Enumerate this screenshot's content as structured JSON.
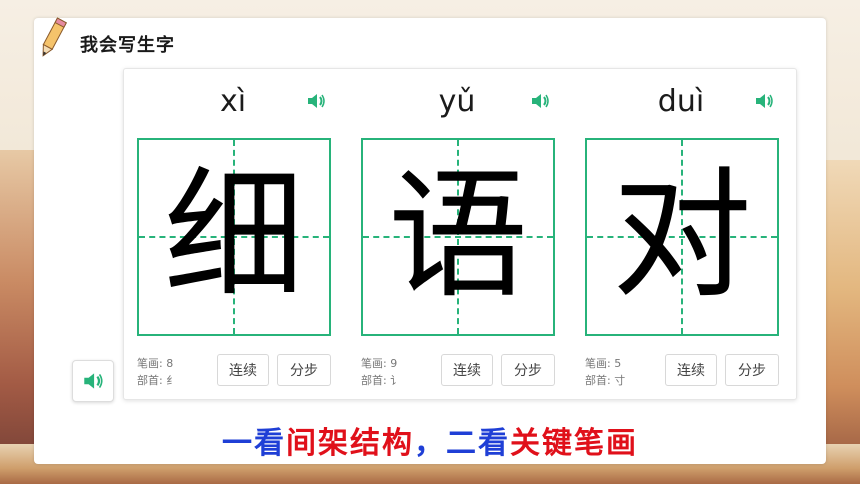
{
  "section": {
    "title": "我会写生字"
  },
  "characters": [
    {
      "pinyin": "xì",
      "hanzi": "细",
      "strokes": "笔画: 8",
      "radical": "部首: 纟",
      "play_label": "连续",
      "step_label": "分步"
    },
    {
      "pinyin": "yǔ",
      "hanzi": "语",
      "strokes": "笔画: 9",
      "radical": "部首: 讠",
      "play_label": "连续",
      "step_label": "分步"
    },
    {
      "pinyin": "duì",
      "hanzi": "对",
      "strokes": "笔画: 5",
      "radical": "部首: 寸",
      "play_label": "连续",
      "step_label": "分步"
    }
  ],
  "caption": {
    "part1": "一看",
    "part2": "间架结构",
    "part3": "，二看",
    "part4": "关键笔画"
  },
  "colors": {
    "accent": "#27b37a",
    "caption_blue": "#1f3fd6",
    "caption_red": "#e0101a"
  },
  "icons": {
    "speaker": "speaker-icon",
    "pencil": "pencil-icon"
  }
}
